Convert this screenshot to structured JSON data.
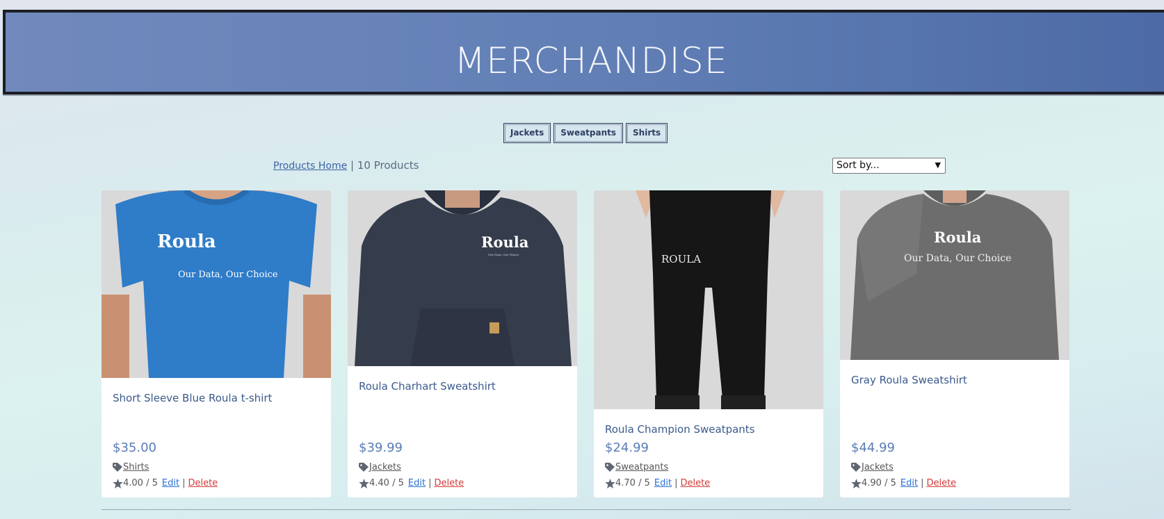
{
  "banner": {
    "title": "MERCHANDISE"
  },
  "categories": [
    "Jackets",
    "Sweatpants",
    "Shirts"
  ],
  "crumbs": {
    "home_link": "Products Home",
    "separator": "|",
    "count": "10 Products"
  },
  "sort": {
    "selected": "Sort by..."
  },
  "colors": {
    "banner": "#6280b6",
    "price": "#5a7cb6",
    "edit": "#2a6fd6",
    "delete": "#d33a3a"
  },
  "products": [
    {
      "name": "Short Sleeve Blue Roula t-shirt",
      "price": "$35.00",
      "category": "Shirts",
      "rating": "4.00 / 5",
      "edit": "Edit",
      "delete": "Delete",
      "sep": "|",
      "brand": "Roula",
      "slogan": "Our Data, Our Choice"
    },
    {
      "name": "Roula Charhart Sweatshirt",
      "price": "$39.99",
      "category": "Jackets",
      "rating": "4.40 / 5",
      "edit": "Edit",
      "delete": "Delete",
      "sep": "|",
      "brand": "Roula",
      "slogan": "Our Data, Our Choice"
    },
    {
      "name": "Roula Champion Sweatpants",
      "price": "$24.99",
      "category": "Sweatpants",
      "rating": "4.70 / 5",
      "edit": "Edit",
      "delete": "Delete",
      "sep": "|",
      "brand": "ROULA",
      "slogan": ""
    },
    {
      "name": "Gray Roula Sweatshirt",
      "price": "$44.99",
      "category": "Jackets",
      "rating": "4.90 / 5",
      "edit": "Edit",
      "delete": "Delete",
      "sep": "|",
      "brand": "Roula",
      "slogan": "Our Data, Our Choice"
    }
  ]
}
